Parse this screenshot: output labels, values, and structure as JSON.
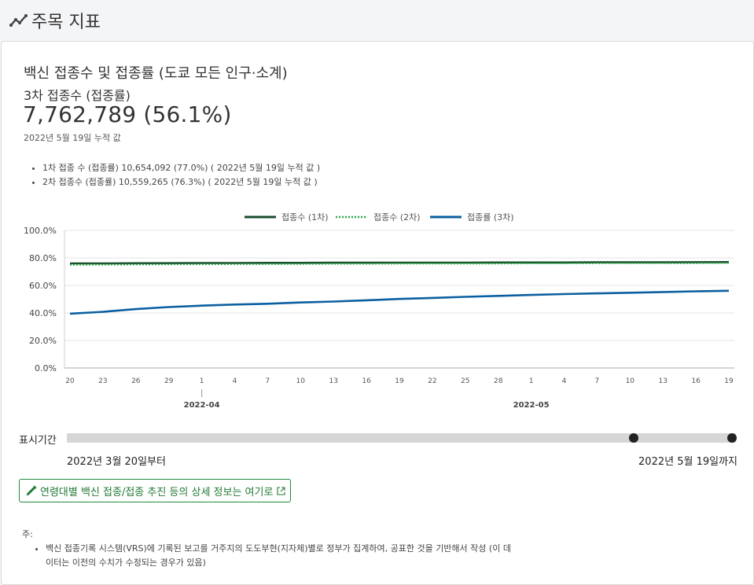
{
  "header": {
    "title": "주목 지표"
  },
  "card": {
    "title": "백신 접종수 및 접종률 (도쿄 모든 인구·소계)",
    "subtitle": "3차 접종수 (접종률)",
    "big_value": "7,762,789 (56.1%)",
    "as_of": "2022년 5월 19일 누적 값",
    "bullets": [
      "1차 접종 수 (접종률) 10,654,092 (77.0%) ( 2022년 5월 19일 누적 값 )",
      "2차 접종수 (접종률) 10,559,265 (76.3%) ( 2022년 5월 19일 누적 값 )"
    ]
  },
  "chart_data": {
    "type": "line",
    "y_ticks": [
      "100.0%",
      "80.0%",
      "60.0%",
      "40.0%",
      "20.0%",
      "0.0%"
    ],
    "ylim": [
      0,
      100
    ],
    "x_ticks": [
      "20",
      "23",
      "26",
      "29",
      "1",
      "4",
      "7",
      "10",
      "13",
      "16",
      "19",
      "22",
      "25",
      "28",
      "1",
      "4",
      "7",
      "10",
      "13",
      "16",
      "19"
    ],
    "month_labels": [
      {
        "label": "2022-04",
        "tick_index": 4
      },
      {
        "label": "2022-05",
        "tick_index": 14
      }
    ],
    "grid": true,
    "legend_position": "top-center",
    "series": [
      {
        "name": "접종수 (1차)",
        "color": "#1a4d2e",
        "style": "solid",
        "values": [
          76.0,
          76.0,
          76.1,
          76.2,
          76.3,
          76.3,
          76.4,
          76.4,
          76.5,
          76.5,
          76.6,
          76.6,
          76.6,
          76.7,
          76.7,
          76.7,
          76.8,
          76.8,
          76.8,
          76.9,
          77.0
        ]
      },
      {
        "name": "접종수 (2차)",
        "color": "#27a844",
        "style": "dotted",
        "values": [
          75.0,
          75.1,
          75.2,
          75.3,
          75.4,
          75.5,
          75.5,
          75.6,
          75.7,
          75.7,
          75.8,
          75.8,
          75.9,
          75.9,
          76.0,
          76.0,
          76.1,
          76.1,
          76.2,
          76.2,
          76.3
        ]
      },
      {
        "name": "접종률 (3차)",
        "color": "#0b5fa0",
        "style": "solid",
        "values": [
          39.5,
          40.8,
          42.8,
          44.3,
          45.3,
          46.1,
          46.7,
          47.6,
          48.3,
          49.2,
          50.2,
          50.9,
          51.7,
          52.4,
          53.1,
          53.7,
          54.2,
          54.7,
          55.2,
          55.7,
          56.1
        ]
      }
    ]
  },
  "range": {
    "label": "표시기간",
    "start": "2022년 3월 20일부터",
    "end": "2022년 5월 19일까지"
  },
  "link": {
    "label": "연령대별 백신 접종/접종 추진 등의 상세 정보는 여기로"
  },
  "notes": {
    "title": "주:",
    "items": [
      "백신 접종기록 시스템(VRS)에 기록된 보고를 거주지의 도도부현(지자체)별로 정부가 집계하여, 공표한 것을 기반해서 작성 (이 데이터는 이전의 수치가 수정되는 경우가 있음)"
    ]
  }
}
